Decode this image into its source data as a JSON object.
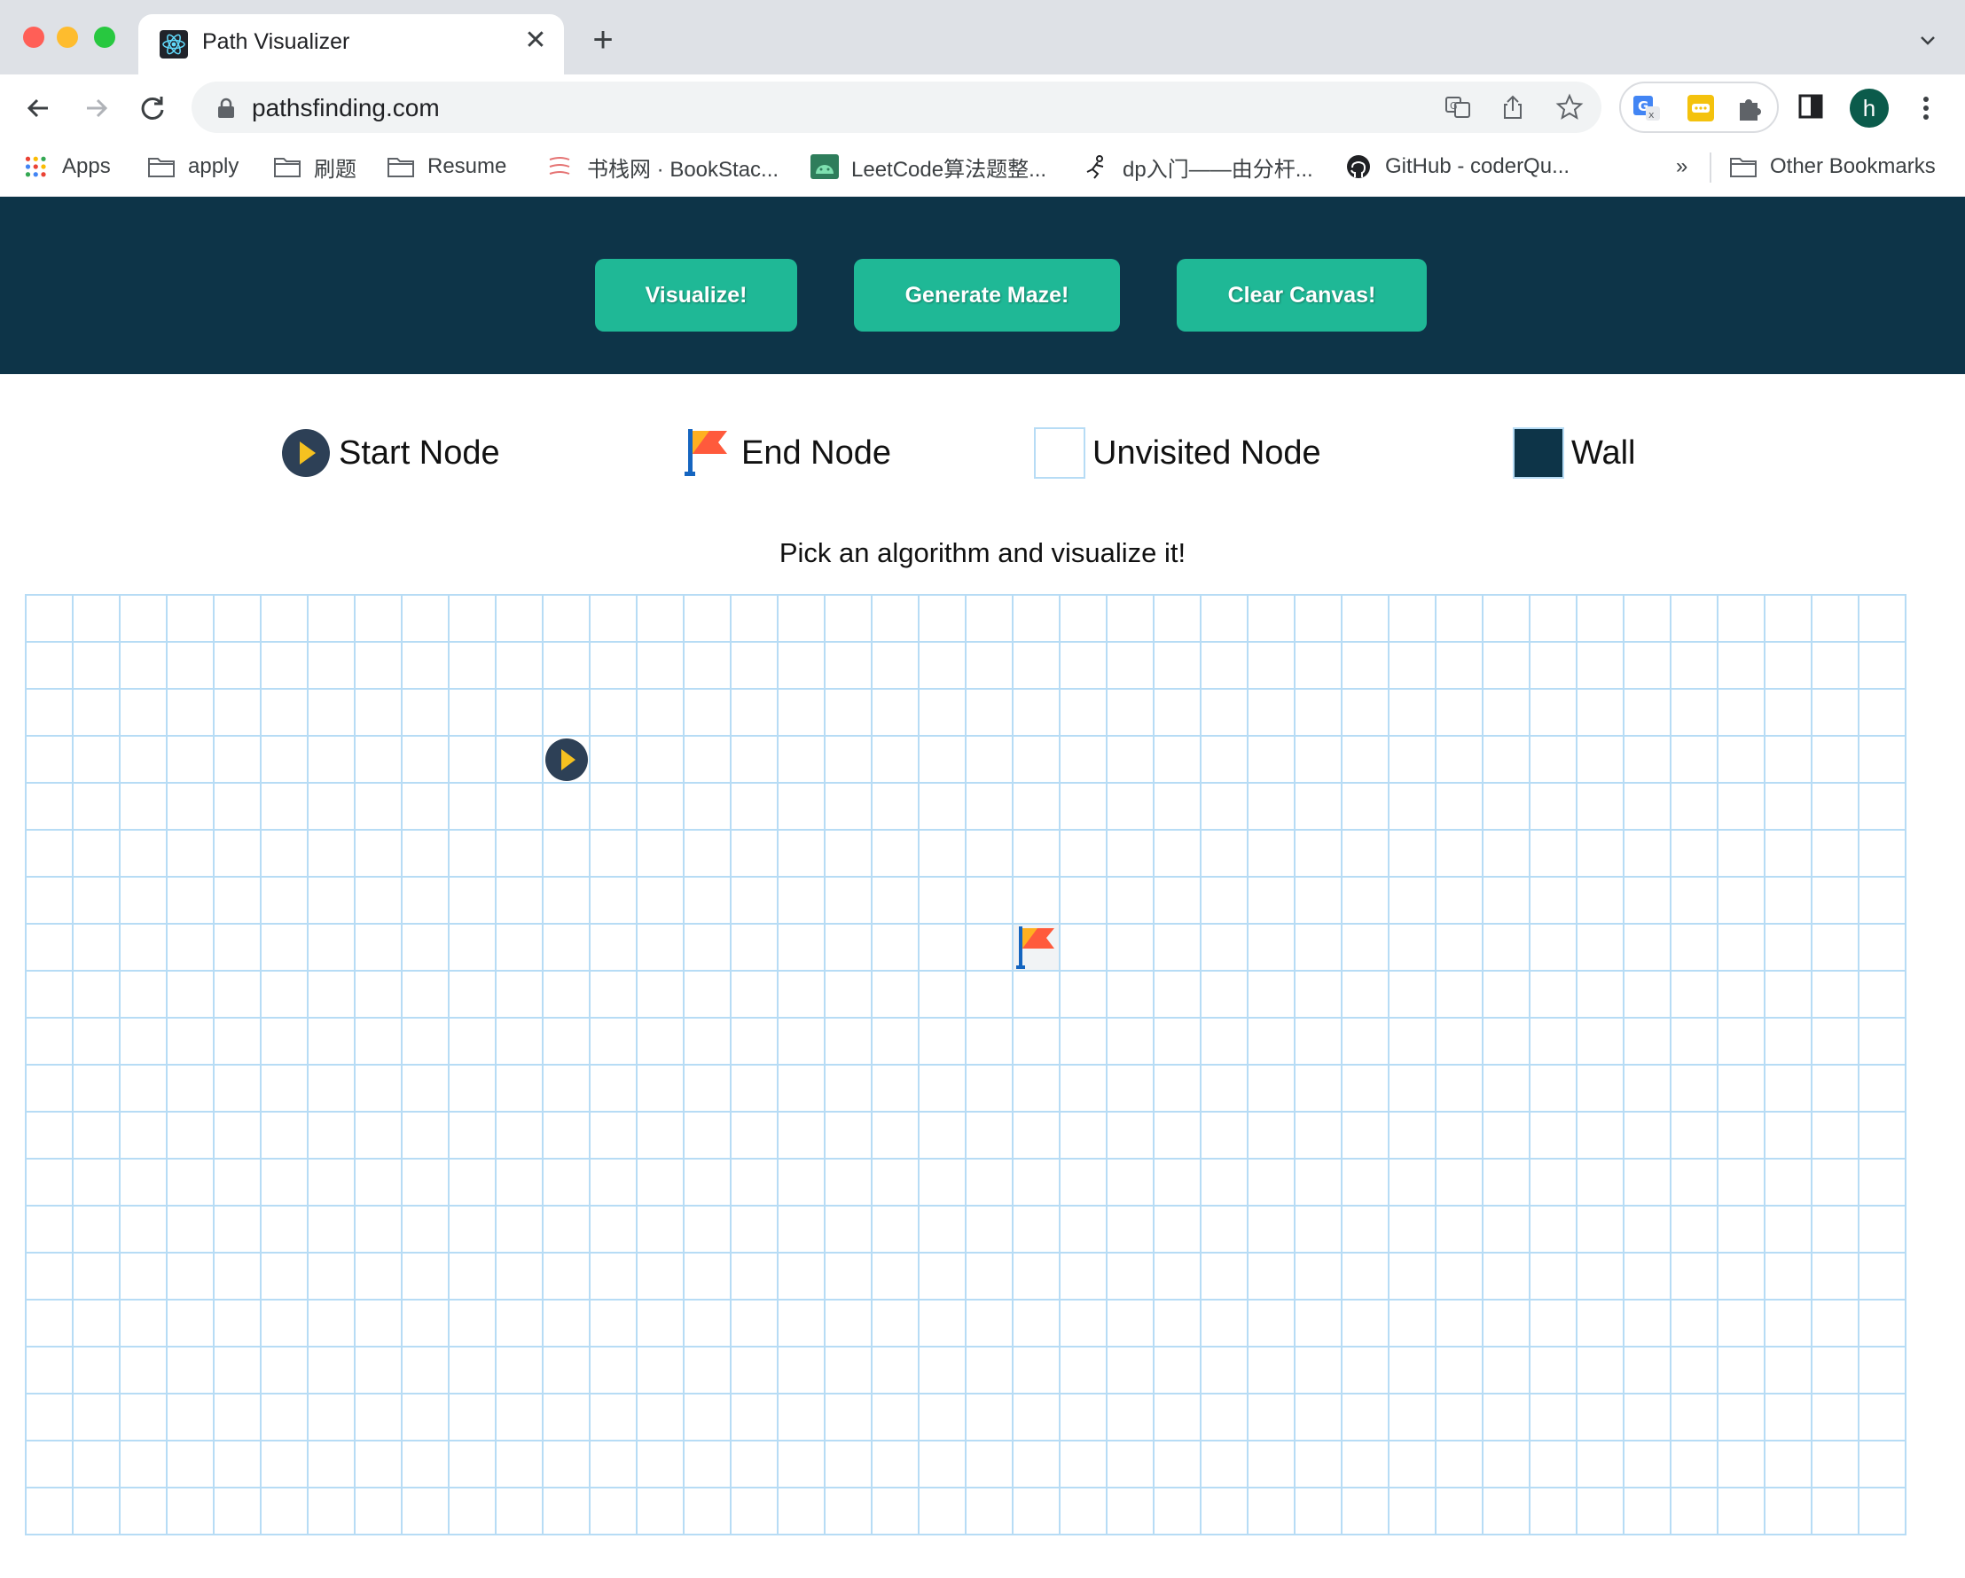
{
  "browser": {
    "tab_title": "Path Visualizer",
    "url": "pathsfinding.com",
    "avatar_letter": "h",
    "bookmarks": [
      {
        "label": "Apps",
        "icon": "apps-grid-icon"
      },
      {
        "label": "apply",
        "icon": "folder-icon"
      },
      {
        "label": "刷题",
        "icon": "folder-icon"
      },
      {
        "label": "Resume",
        "icon": "folder-icon"
      },
      {
        "label": "书栈网 · BookStac...",
        "icon": "bookstack-icon"
      },
      {
        "label": "LeetCode算法题整...",
        "icon": "android-icon"
      },
      {
        "label": "dp入门——由分杆...",
        "icon": "runner-icon"
      },
      {
        "label": "GitHub - coderQu...",
        "icon": "github-icon"
      }
    ],
    "overflow_label": "»",
    "other_bookmarks": "Other Bookmarks"
  },
  "header": {
    "buttons": {
      "visualize": "Visualize!",
      "maze": "Generate Maze!",
      "clear": "Clear Canvas!"
    }
  },
  "legend": {
    "start": "Start Node",
    "end": "End Node",
    "unvisited": "Unvisited Node",
    "wall": "Wall"
  },
  "subtitle": "Pick an algorithm and visualize it!",
  "grid": {
    "rows": 20,
    "cols": 40,
    "start": {
      "row": 3,
      "col": 11
    },
    "end": {
      "row": 7,
      "col": 21
    },
    "walls": []
  },
  "colors": {
    "header_bg": "#0d3448",
    "button_bg": "#1fb896",
    "grid_line": "#b7dcf5",
    "wall": "#0d3448"
  }
}
